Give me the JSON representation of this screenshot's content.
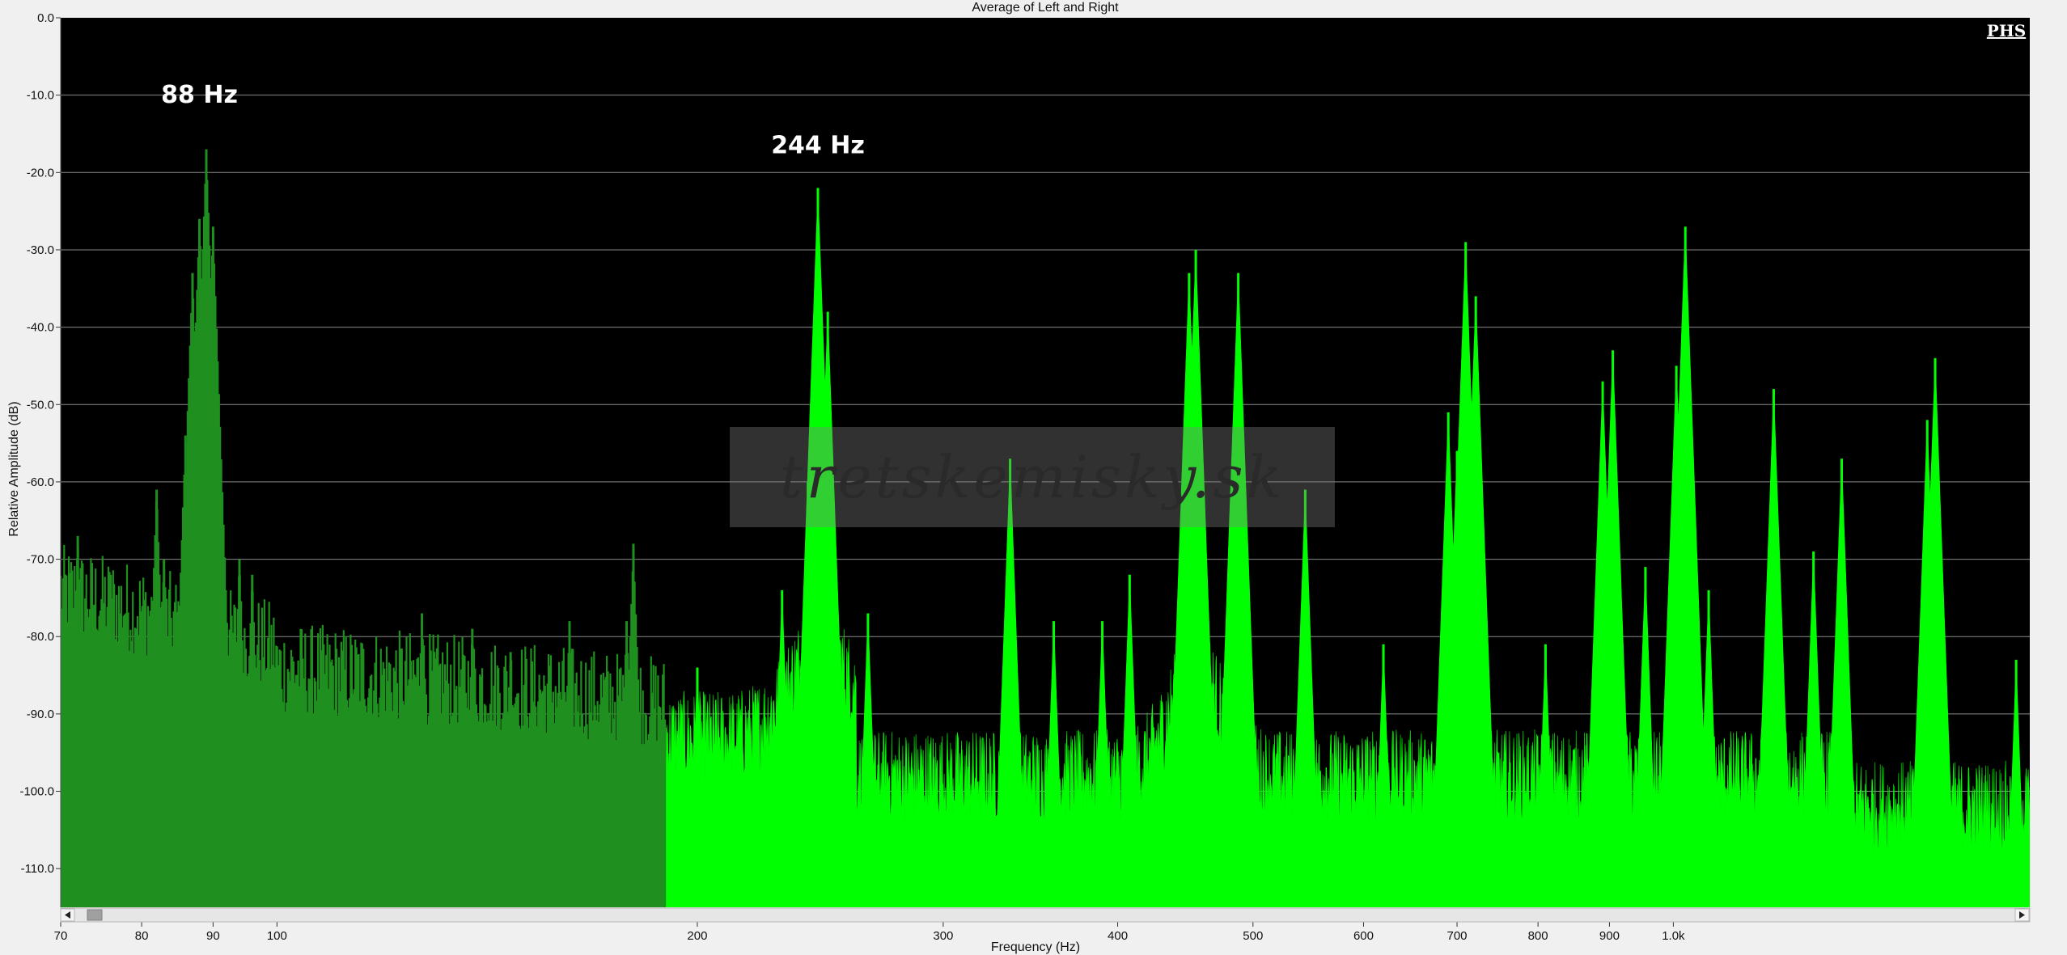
{
  "chart_data": {
    "type": "area",
    "title": "Average of Left and Right",
    "xlabel": "Frequency (Hz)",
    "ylabel": "Relative Amplitude (dB)",
    "x_scale": "log",
    "xlim": [
      70,
      1800
    ],
    "ylim": [
      -115,
      0
    ],
    "grid": true,
    "background": "#000000",
    "colors": {
      "fill_bright": "#00ff00",
      "fill_dark": "#1f8f1f",
      "gridline": "#8a8a8a"
    },
    "x_ticks": [
      {
        "value": 70,
        "label": "70"
      },
      {
        "value": 80,
        "label": "80"
      },
      {
        "value": 90,
        "label": "90"
      },
      {
        "value": 100,
        "label": "100"
      },
      {
        "value": 200,
        "label": "200"
      },
      {
        "value": 300,
        "label": "300"
      },
      {
        "value": 400,
        "label": "400"
      },
      {
        "value": 500,
        "label": "500"
      },
      {
        "value": 600,
        "label": "600"
      },
      {
        "value": 700,
        "label": "700"
      },
      {
        "value": 800,
        "label": "800"
      },
      {
        "value": 900,
        "label": "900"
      },
      {
        "value": 1000,
        "label": "1.0k"
      }
    ],
    "y_ticks": [
      {
        "value": 0,
        "label": "0.0"
      },
      {
        "value": -10,
        "label": "-10.0"
      },
      {
        "value": -20,
        "label": "-20.0"
      },
      {
        "value": -30,
        "label": "-30.0"
      },
      {
        "value": -40,
        "label": "-40.0"
      },
      {
        "value": -50,
        "label": "-50.0"
      },
      {
        "value": -60,
        "label": "-60.0"
      },
      {
        "value": -70,
        "label": "-70.0"
      },
      {
        "value": -80,
        "label": "-80.0"
      },
      {
        "value": -90,
        "label": "-90.0"
      },
      {
        "value": -100,
        "label": "-100.0"
      },
      {
        "value": -110,
        "label": "-110.0"
      }
    ],
    "annotations": [
      {
        "text": "88 Hz",
        "x": 88,
        "y": -11
      },
      {
        "text": "244 Hz",
        "x": 244,
        "y": -17.5
      }
    ],
    "peaks": [
      {
        "x": 72,
        "y": -67
      },
      {
        "x": 76,
        "y": -72
      },
      {
        "x": 82,
        "y": -61
      },
      {
        "x": 83,
        "y": -70
      },
      {
        "x": 86,
        "y": -54
      },
      {
        "x": 87,
        "y": -33
      },
      {
        "x": 88,
        "y": -26
      },
      {
        "x": 89,
        "y": -17
      },
      {
        "x": 90,
        "y": -27
      },
      {
        "x": 91,
        "y": -70
      },
      {
        "x": 94,
        "y": -70
      },
      {
        "x": 96,
        "y": -72
      },
      {
        "x": 127,
        "y": -77
      },
      {
        "x": 138,
        "y": -79
      },
      {
        "x": 147,
        "y": -82
      },
      {
        "x": 162,
        "y": -78
      },
      {
        "x": 178,
        "y": -78
      },
      {
        "x": 180,
        "y": -68
      },
      {
        "x": 200,
        "y": -84
      },
      {
        "x": 230,
        "y": -74
      },
      {
        "x": 240,
        "y": -60
      },
      {
        "x": 244,
        "y": -22
      },
      {
        "x": 248,
        "y": -38
      },
      {
        "x": 265,
        "y": -77
      },
      {
        "x": 335,
        "y": -57
      },
      {
        "x": 360,
        "y": -78
      },
      {
        "x": 390,
        "y": -78
      },
      {
        "x": 408,
        "y": -72
      },
      {
        "x": 450,
        "y": -33
      },
      {
        "x": 455,
        "y": -30
      },
      {
        "x": 488,
        "y": -33
      },
      {
        "x": 545,
        "y": -61
      },
      {
        "x": 620,
        "y": -81
      },
      {
        "x": 690,
        "y": -51
      },
      {
        "x": 700,
        "y": -56
      },
      {
        "x": 710,
        "y": -29
      },
      {
        "x": 722,
        "y": -36
      },
      {
        "x": 810,
        "y": -81
      },
      {
        "x": 890,
        "y": -47
      },
      {
        "x": 905,
        "y": -43
      },
      {
        "x": 955,
        "y": -71
      },
      {
        "x": 1005,
        "y": -45
      },
      {
        "x": 1020,
        "y": -27
      },
      {
        "x": 1060,
        "y": -74
      },
      {
        "x": 1180,
        "y": -48
      },
      {
        "x": 1260,
        "y": -69
      },
      {
        "x": 1320,
        "y": -57
      },
      {
        "x": 1540,
        "y": -44
      },
      {
        "x": 1520,
        "y": -52
      },
      {
        "x": 1760,
        "y": -83
      }
    ]
  },
  "logo": "PHS",
  "watermark": "tretskemisky.sk"
}
